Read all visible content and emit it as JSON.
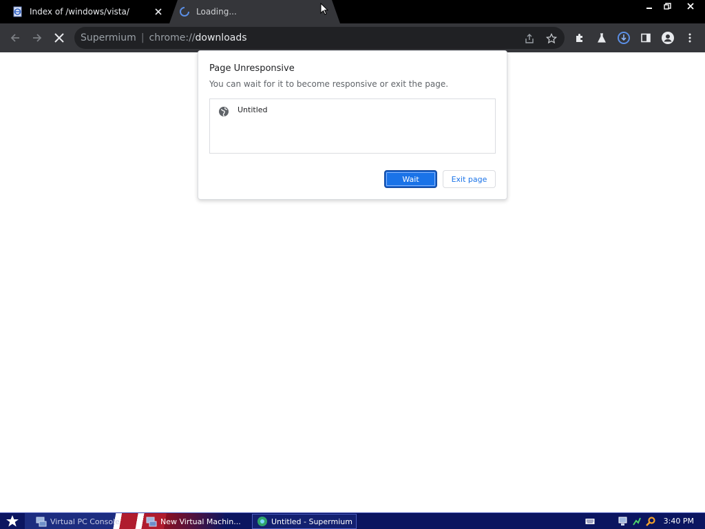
{
  "browser": {
    "tabs": [
      {
        "title": "Index of /windows/vista/",
        "active": false
      },
      {
        "title": "Loading...",
        "active": true
      }
    ],
    "omnibox": {
      "brand": "Supermium",
      "separator": "|",
      "url_scheme": "chrome://",
      "url_host": "downloads"
    }
  },
  "dialog": {
    "title": "Page Unresponsive",
    "message": "You can wait for it to become responsive or exit the page.",
    "pages": [
      {
        "title": "Untitled",
        "icon": "globe-icon"
      }
    ],
    "wait_label": "Wait",
    "exit_label": "Exit page"
  },
  "taskbar": {
    "items": [
      {
        "label": "Virtual PC Console",
        "icon": "virtual-pc-icon"
      },
      {
        "label": "New Virtual Machin...",
        "icon": "virtual-pc-icon"
      },
      {
        "label": "Untitled - Supermium",
        "icon": "supermium-icon"
      }
    ],
    "clock": "3:40 PM"
  },
  "colors": {
    "accent": "#1a73e8",
    "toolbar": "#35363a",
    "omnibox": "#202124",
    "taskbar": "#0b1560"
  }
}
